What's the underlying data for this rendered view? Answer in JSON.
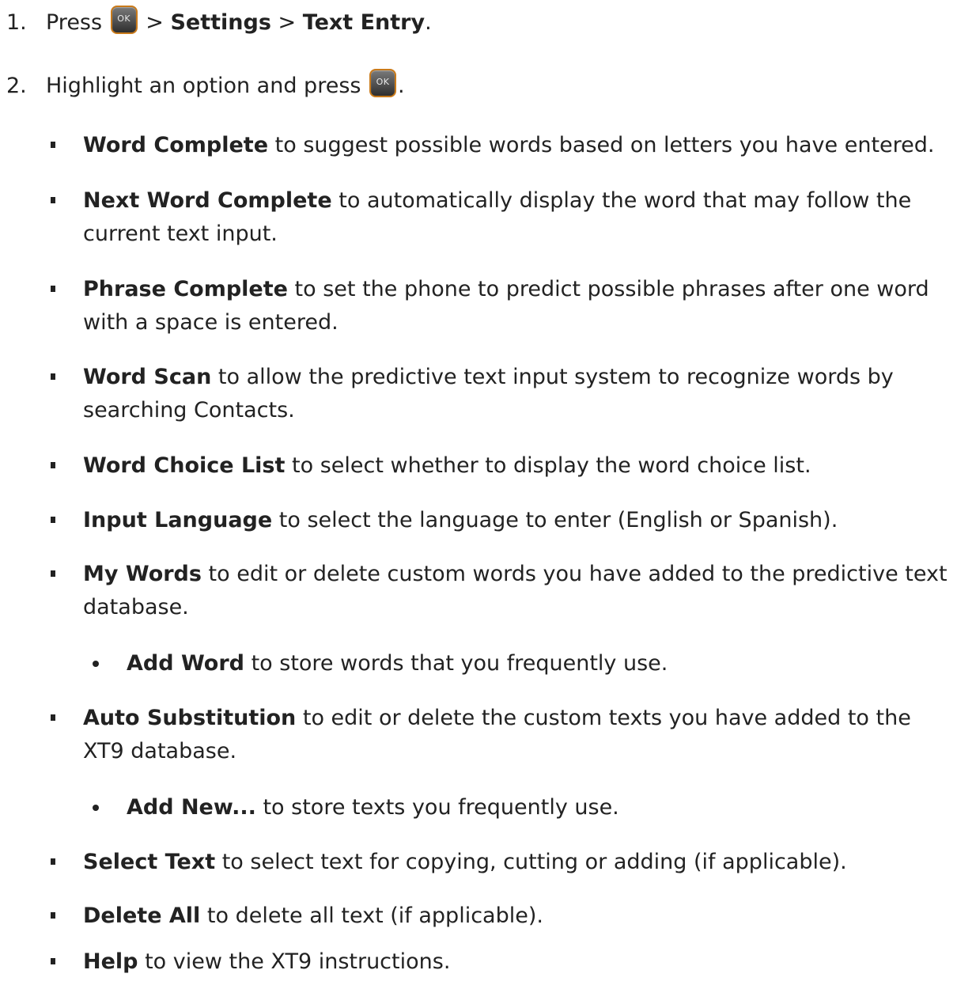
{
  "steps": [
    {
      "number": "1.",
      "prefix": "Press",
      "key_label": "OK",
      "sep1": ">",
      "menu1": "Settings",
      "sep2": ">",
      "menu2": "Text Entry",
      "end": "."
    },
    {
      "number": "2.",
      "text": "Highlight an option and press",
      "key_label": "OK",
      "end": "."
    }
  ],
  "options": [
    {
      "name": "Word Complete",
      "desc": "to suggest possible words based on letters you have entered."
    },
    {
      "name": "Next Word Complete",
      "desc": "to automatically display the word that may follow the",
      "desc2": "current text input."
    },
    {
      "name": "Phrase Complete",
      "desc": "to set the phone to predict possible phrases after one word",
      "desc2": "with a space is entered."
    },
    {
      "name": "Word Scan",
      "desc": "to allow the predictive text input system to recognize words by",
      "desc2": "searching Contacts."
    },
    {
      "name": "Word Choice List",
      "desc": "to select whether to display the word choice list."
    },
    {
      "name": "Input Language",
      "desc": "to select the language to enter (English or Spanish)."
    },
    {
      "name": "My Words",
      "desc": "to edit or delete custom words you have added to the predictive text",
      "desc2": "database."
    },
    {
      "name": "Auto Substitution",
      "desc": "to edit or delete the custom texts you have added to the",
      "desc2": "XT9 database."
    },
    {
      "name": "Select Text",
      "desc": "to select text for copying, cutting or adding (if applicable)."
    },
    {
      "name": "Delete All",
      "desc": "to delete all text (if applicable)."
    },
    {
      "name": "Help",
      "desc": "to view the XT9 instructions."
    }
  ],
  "sub_options": [
    {
      "name": "Add Word",
      "desc": "to store words that you frequently use."
    },
    {
      "name": "Add New...",
      "desc": "to store texts you frequently use."
    }
  ]
}
